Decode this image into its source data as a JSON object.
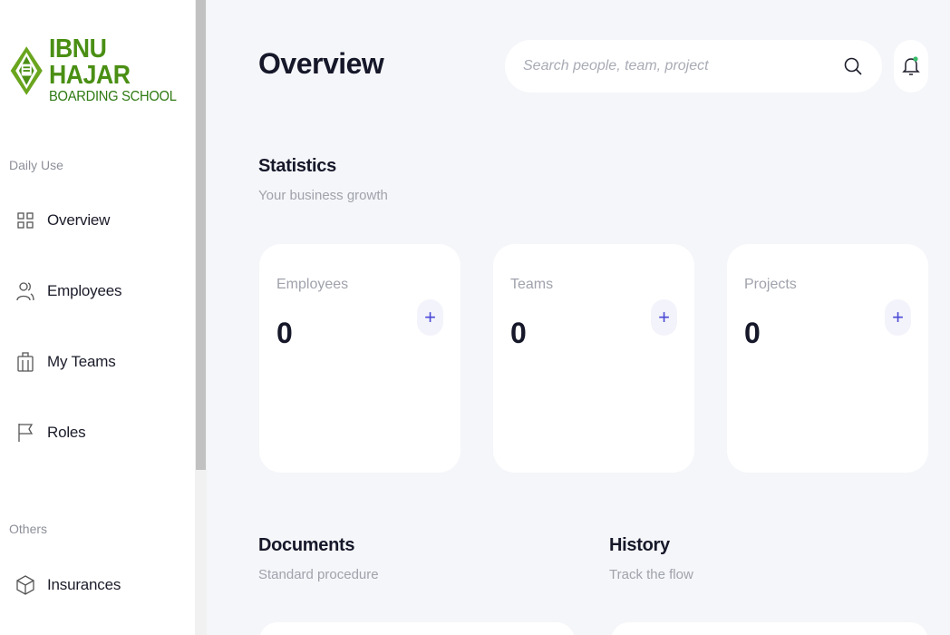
{
  "brand": {
    "title": "IBNU HAJAR",
    "subtitle": "BOARDING SCHOOL",
    "colors": {
      "primary": "#4a8f14",
      "accent": "#4b49d6"
    }
  },
  "sidebar": {
    "sections": [
      {
        "label": "Daily Use"
      },
      {
        "label": "Others"
      }
    ],
    "items": [
      {
        "label": "Overview",
        "icon": "grid-icon"
      },
      {
        "label": "Employees",
        "icon": "users-icon"
      },
      {
        "label": "My Teams",
        "icon": "briefcase-icon"
      },
      {
        "label": "Roles",
        "icon": "flag-icon"
      },
      {
        "label": "Insurances",
        "icon": "box-icon"
      }
    ]
  },
  "header": {
    "title": "Overview",
    "search_placeholder": "Search people, team, project"
  },
  "statistics": {
    "title": "Statistics",
    "subtitle": "Your business growth",
    "cards": [
      {
        "label": "Employees",
        "value": "0"
      },
      {
        "label": "Teams",
        "value": "0"
      },
      {
        "label": "Projects",
        "value": "0"
      }
    ]
  },
  "documents": {
    "title": "Documents",
    "subtitle": "Standard procedure"
  },
  "history": {
    "title": "History",
    "subtitle": "Track the flow"
  }
}
